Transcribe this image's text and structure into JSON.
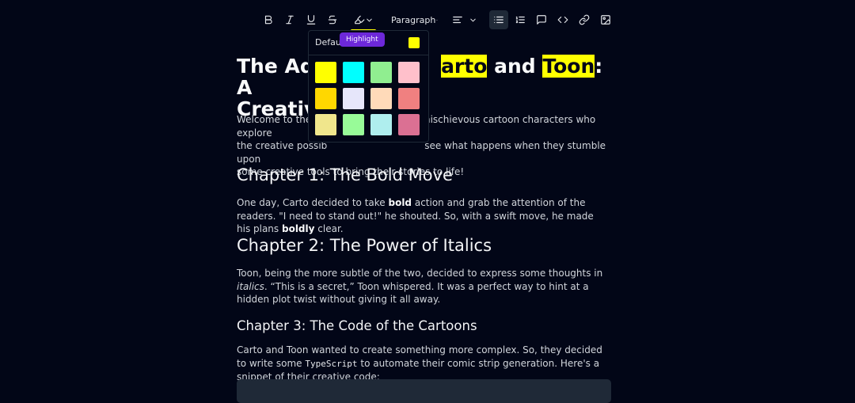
{
  "toolbar": {
    "paragraph_label": "Paragraph",
    "highlight_color": "#ffff00",
    "tooltip": "Highlight"
  },
  "highlight_popover": {
    "default_label": "Default",
    "default_color": "#ffff00",
    "swatches": [
      "#ffff00",
      "#00ffff",
      "#90ee90",
      "#ffc0cb",
      "#ffd700",
      "#e6e6fa",
      "#ffdab9",
      "#f08080",
      "#f0e68c",
      "#98fb98",
      "#afeeee",
      "#db7093"
    ]
  },
  "doc": {
    "title_pre": "The Adv",
    "title_mark1": "arto",
    "title_and": " and ",
    "title_mark2": "Toon",
    "title_post": ": A",
    "title_line2": "Creative",
    "intro_a": "Welcome to the fu",
    "intro_b": "mischievous cartoon characters who explore",
    "intro_c": "the creative possib",
    "intro_d": "see what happens when they stumble upon",
    "intro_e": "some creative tools to bring their stories to life!",
    "ch1_title": "Chapter 1: The Bold Move",
    "ch1_p1": "One day, Carto decided to take ",
    "ch1_bold1": "bold",
    "ch1_p2": " action and grab the attention of the readers. \"I need to stand out!\" he shouted. So, with a swift move, he made his plans ",
    "ch1_bold2": "boldly",
    "ch1_p3": " clear.",
    "ch2_title": "Chapter 2: The Power of Italics",
    "ch2_p1": "Toon, being the more subtle of the two, decided to express some thoughts in ",
    "ch2_italic": "italics",
    "ch2_p2": ". “This is a secret,” Toon whispered. It was a perfect way to hint at a hidden plot twist without giving it all away.",
    "ch3_title": "Chapter 3: The Code of the Cartoons",
    "ch3_p1": "Carto and Toon wanted to create something more complex. So, they decided to write some ",
    "ch3_code": "TypeScript",
    "ch3_p2": " to automate their comic strip generation. Here's a snippet of their creative code:"
  }
}
